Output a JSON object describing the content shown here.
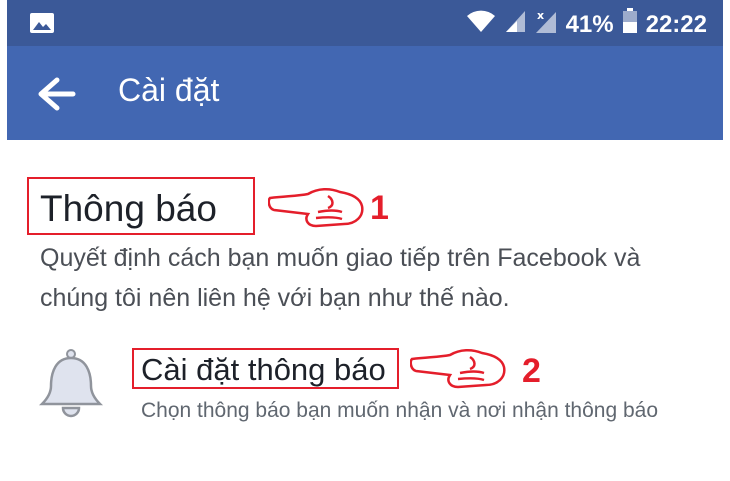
{
  "status_bar": {
    "battery_percent": "41%",
    "time": "22:22",
    "icons": [
      "image-icon",
      "wifi-icon",
      "signal-icon",
      "signal-no-sim-icon",
      "battery-icon"
    ]
  },
  "app_bar": {
    "title": "Cài đặt",
    "back_icon": "arrow-left-icon"
  },
  "section": {
    "title": "Thông báo",
    "description": "Quyết định cách bạn muốn giao tiếp trên Facebook và chúng tôi nên liên hệ với bạn như thế nào."
  },
  "items": [
    {
      "icon": "bell-icon",
      "title": "Cài đặt thông báo",
      "description": "Chọn thông báo bạn muốn nhận và nơi nhận thông báo"
    }
  ],
  "annotations": [
    {
      "label": "1"
    },
    {
      "label": "2"
    }
  ],
  "colors": {
    "status_bar": "#3b5998",
    "app_bar": "#4267b2",
    "annotation": "#e41e2b"
  }
}
